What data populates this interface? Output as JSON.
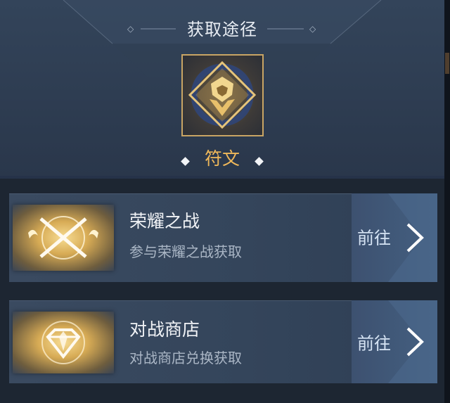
{
  "header": {
    "title": "获取途径"
  },
  "item": {
    "name": "符文",
    "icon": "rune-icon"
  },
  "sources": [
    {
      "title": "荣耀之战",
      "subtitle": "参与荣耀之战获取",
      "icon": "crossed-swords-icon",
      "action_label": "前往"
    },
    {
      "title": "对战商店",
      "subtitle": "对战商店兑换获取",
      "icon": "diamond-gem-icon",
      "action_label": "前往"
    }
  ],
  "colors": {
    "accent_gold": "#f1b95a",
    "panel": "#2c3a4e",
    "button": "#446081"
  }
}
